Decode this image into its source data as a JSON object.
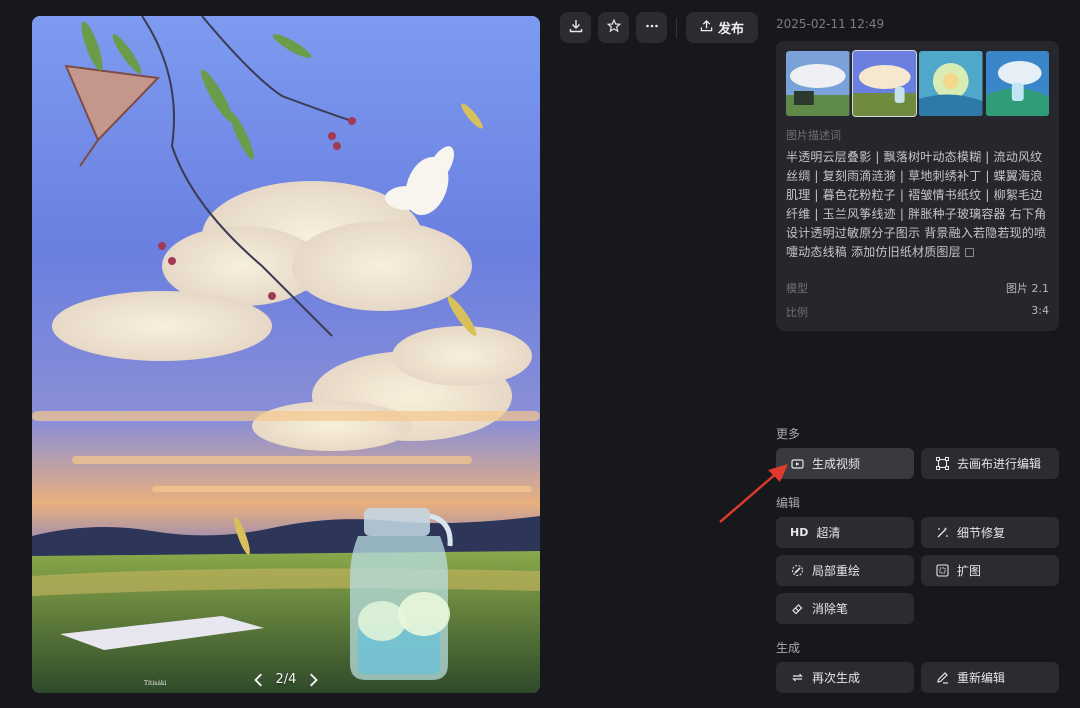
{
  "toolbar": {
    "download_icon": "download-icon",
    "star_icon": "star-icon",
    "more_icon": "more-icon",
    "publish_label": "发布"
  },
  "image": {
    "page_indicator": "2/4",
    "signature": "Títisáki"
  },
  "info": {
    "timestamp": "2025-02-11 12:49",
    "desc_title": "图片描述词",
    "description": "半透明云层叠影 | 飘落树叶动态模糊 | 流动风纹丝绸 | 复刻雨滴涟漪 | 草地刺绣补丁 | 蝶翼海浪肌理 | 暮色花粉粒子 | 褶皱情书纸纹 | 柳絮毛边纤维 | 玉兰风筝线迹 | 胖胀种子玻璃容器 右下角设计透明过敏原分子图示 背景融入若隐若现的喷嚏动态线稿 添加仿旧纸材质图层",
    "model_label": "模型",
    "model_value": "图片 2.1",
    "ratio_label": "比例",
    "ratio_value": "3:4"
  },
  "sections": {
    "more": "更多",
    "edit": "编辑",
    "generate": "生成"
  },
  "actions": {
    "gen_video": "生成视频",
    "canvas_edit": "去画布进行编辑",
    "hd_badge": "HD",
    "upscale": "超清",
    "detail_fix": "细节修复",
    "inpaint": "局部重绘",
    "outpaint": "扩图",
    "eraser": "消除笔",
    "regenerate": "再次生成",
    "re_edit": "重新编辑"
  },
  "colors": {
    "background": "#17181c",
    "card": "#26272c",
    "button": "#2b2c32",
    "highlight_button": "#393a40",
    "annotation_arrow": "#e23b2e"
  }
}
